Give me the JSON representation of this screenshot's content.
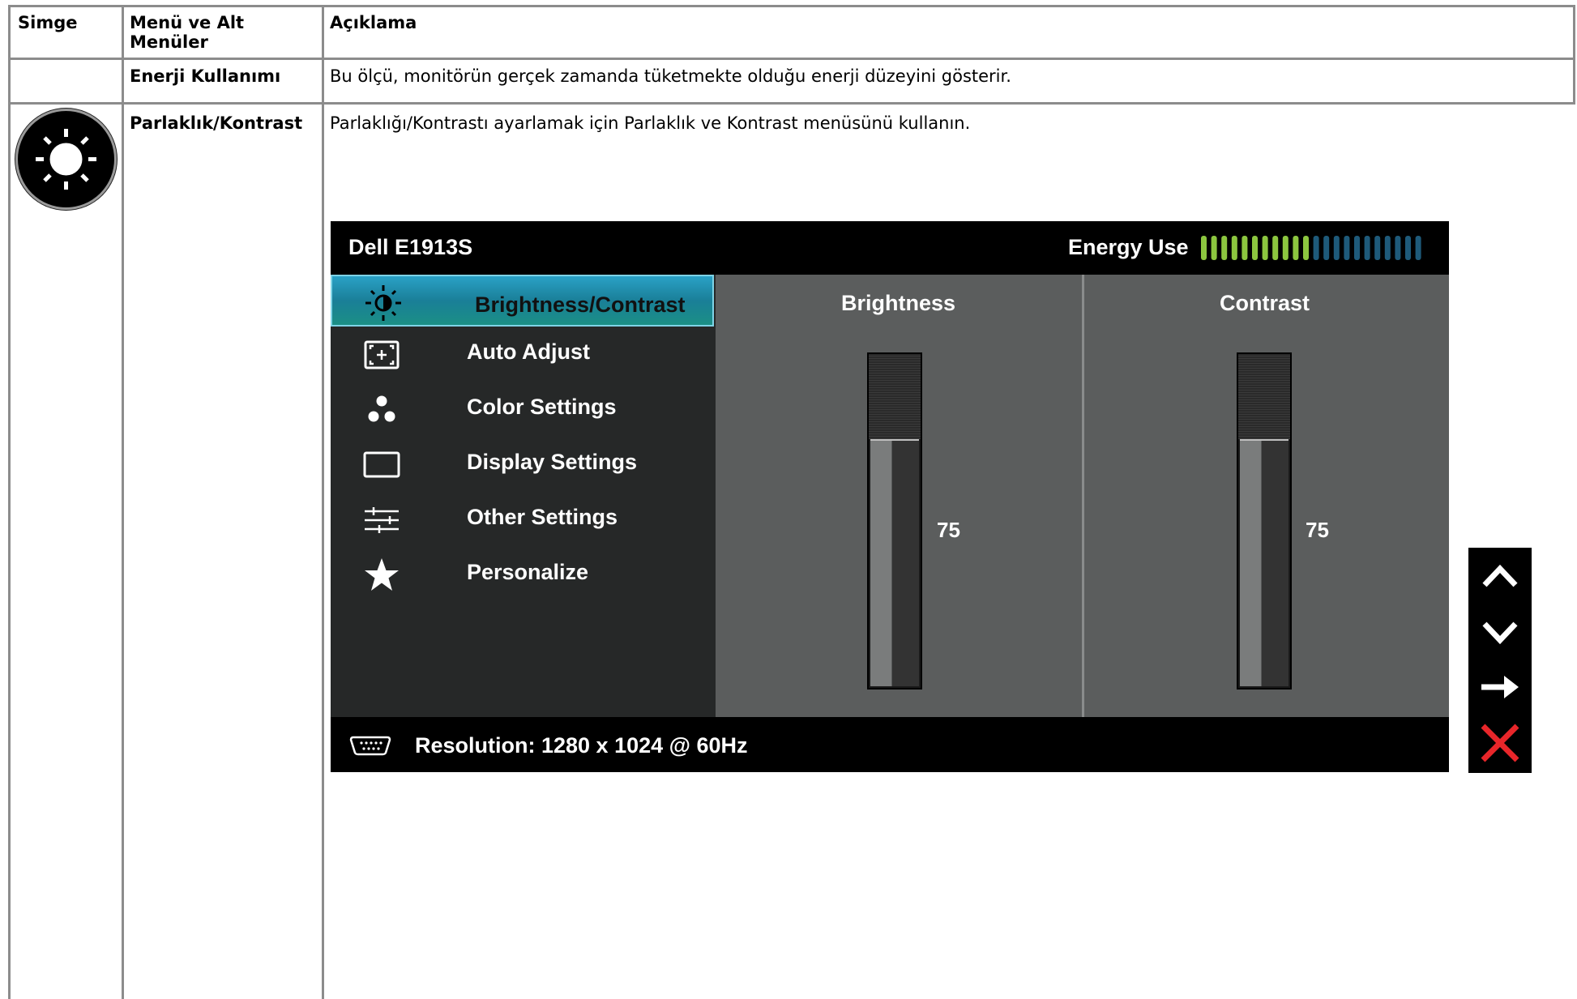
{
  "table": {
    "headers": {
      "icon": "Simge",
      "menu_line1": "Menü ve Alt",
      "menu_line2": "Menüler",
      "description": "Açıklama"
    },
    "rows": [
      {
        "menu": "Enerji Kullanımı",
        "description": "Bu ölçü, monitörün gerçek zamanda tüketmekte olduğu enerji düzeyini gösterir."
      },
      {
        "icon": "brightness-contrast-icon",
        "menu": "Parlaklık/Kontrast",
        "description": "Parlaklığı/Kontrastı ayarlamak için Parlaklık ve Kontrast menüsünü kullanın."
      }
    ]
  },
  "osd": {
    "model": "Dell E1913S",
    "energy_label": "Energy Use",
    "energy_level": {
      "lit": 11,
      "total": 22
    },
    "menu": [
      {
        "label": "Brightness/Contrast",
        "icon": "brightness-contrast-icon",
        "active": true
      },
      {
        "label": "Auto Adjust",
        "icon": "auto-adjust-icon",
        "active": false
      },
      {
        "label": "Color Settings",
        "icon": "color-settings-icon",
        "active": false
      },
      {
        "label": "Display Settings",
        "icon": "display-settings-icon",
        "active": false
      },
      {
        "label": "Other Settings",
        "icon": "other-settings-icon",
        "active": false
      },
      {
        "label": "Personalize",
        "icon": "star-icon",
        "active": false
      }
    ],
    "brightness": {
      "label": "Brightness",
      "value": "75",
      "level": 75
    },
    "contrast": {
      "label": "Contrast",
      "value": "75",
      "level": 75
    },
    "resolution": "Resolution: 1280 x 1024 @ 60Hz"
  },
  "nav_buttons": [
    "up-arrow-icon",
    "down-arrow-icon",
    "right-arrow-icon",
    "close-icon"
  ],
  "colors": {
    "active_menu": "#2aa1c6",
    "energy_on": "#8cc63f",
    "energy_off": "#1e5a7a",
    "close_red": "#e8262a"
  }
}
